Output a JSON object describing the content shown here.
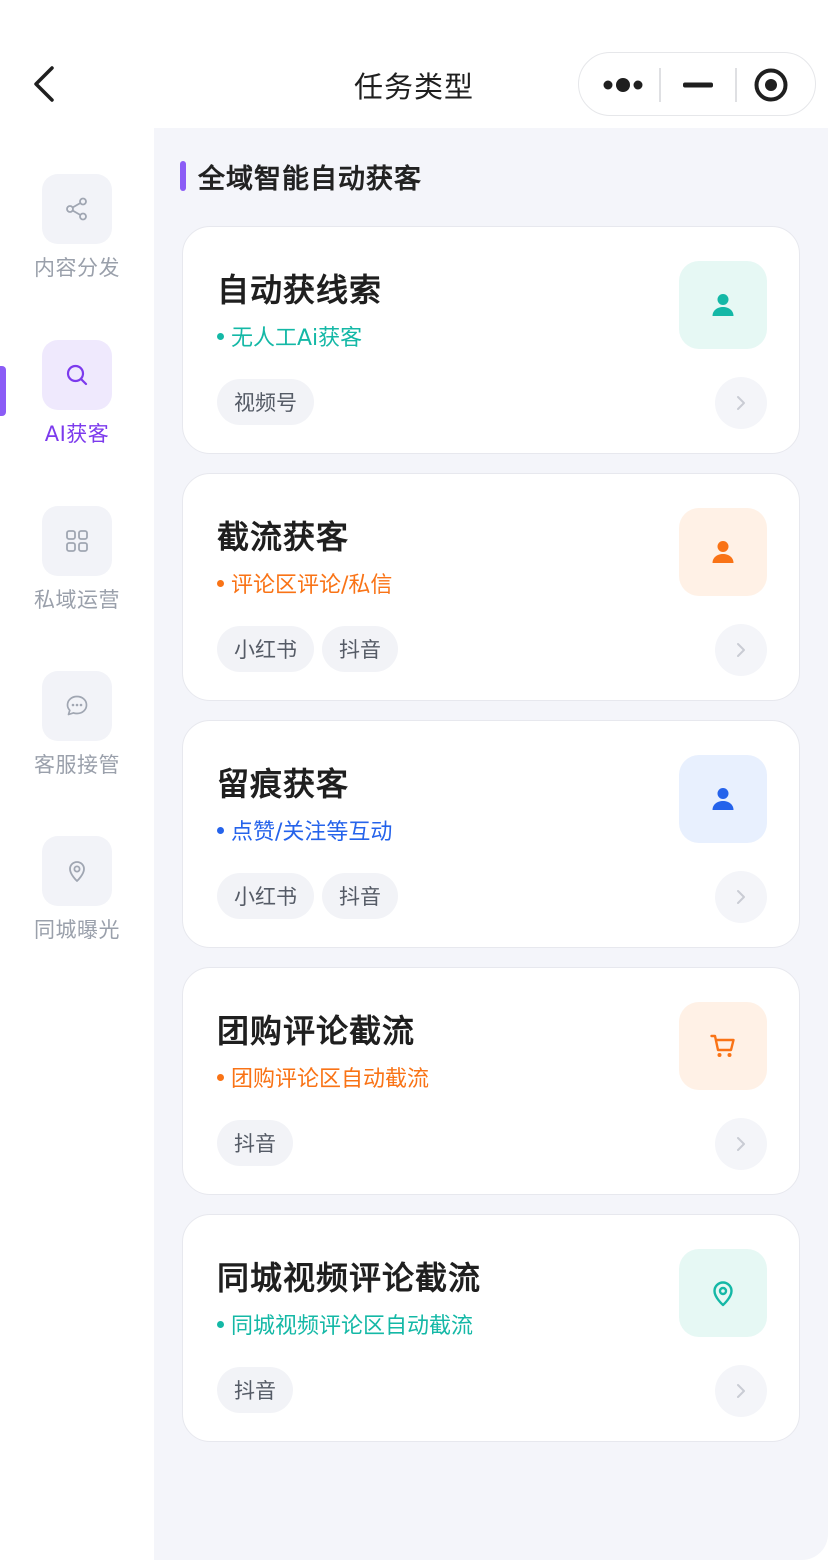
{
  "header": {
    "title": "任务类型",
    "back_icon": "chevron-left-icon",
    "capsule": {
      "more_icon": "more-dots-icon",
      "minimize_icon": "minimize-icon",
      "close_icon": "target-circle-icon"
    }
  },
  "sidebar": {
    "items": [
      {
        "label": "内容分发",
        "icon": "share-icon",
        "active": false
      },
      {
        "label": "AI获客",
        "icon": "search-icon",
        "active": true
      },
      {
        "label": "私域运营",
        "icon": "grid-icon",
        "active": false
      },
      {
        "label": "客服接管",
        "icon": "chat-bubble-icon",
        "active": false
      },
      {
        "label": "同城曝光",
        "icon": "location-pin-icon",
        "active": false
      }
    ],
    "active_color": "#7c3aed"
  },
  "section": {
    "title": "全域智能自动获客"
  },
  "cards": [
    {
      "title": "自动获线索",
      "subtitle": "无人工Ai获客",
      "accent": "#14b8a6",
      "icon_bg": "#e6f8f4",
      "icon": "user-icon",
      "tags": [
        "视频号"
      ]
    },
    {
      "title": "截流获客",
      "subtitle": "评论区评论/私信",
      "accent": "#f97316",
      "icon_bg": "#fff1e6",
      "icon": "user-icon",
      "tags": [
        "小红书",
        "抖音"
      ]
    },
    {
      "title": "留痕获客",
      "subtitle": "点赞/关注等互动",
      "accent": "#2563eb",
      "icon_bg": "#e8f0fe",
      "icon": "user-icon",
      "tags": [
        "小红书",
        "抖音"
      ]
    },
    {
      "title": "团购评论截流",
      "subtitle": "团购评论区自动截流",
      "accent": "#f97316",
      "icon_bg": "#fff1e6",
      "icon": "cart-icon",
      "tags": [
        "抖音"
      ]
    },
    {
      "title": "同城视频评论截流",
      "subtitle": "同城视频评论区自动截流",
      "accent": "#14b8a6",
      "icon_bg": "#e6f8f4",
      "icon": "location-pin-icon",
      "tags": [
        "抖音"
      ]
    }
  ]
}
